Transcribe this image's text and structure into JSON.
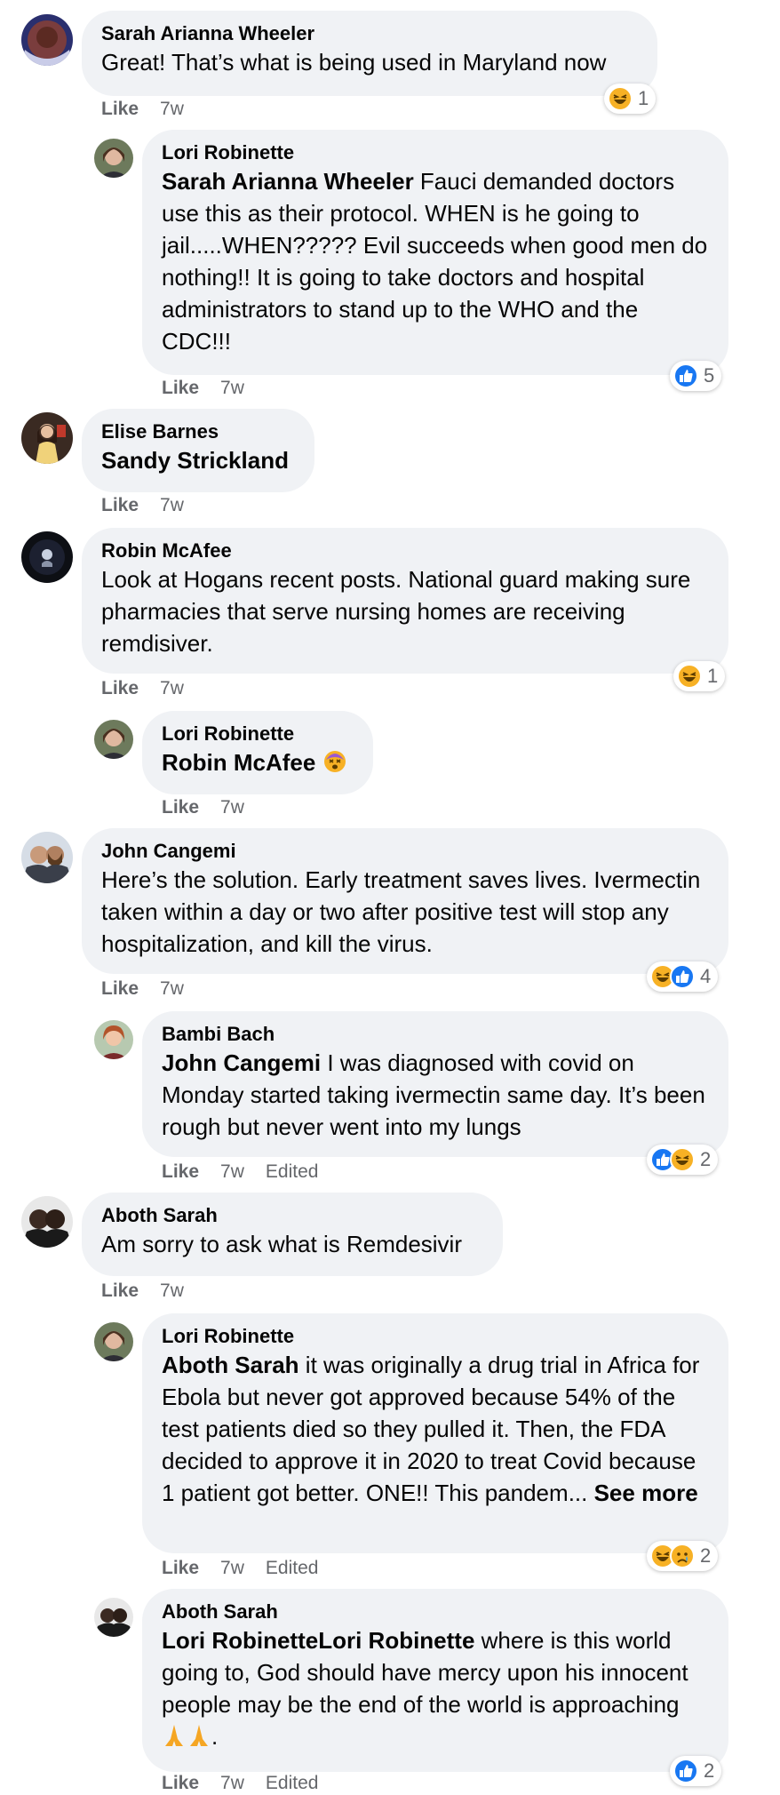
{
  "ui": {
    "like_label": "Like",
    "edited_label": "Edited",
    "see_more_label": "See more",
    "ellipsis": "..."
  },
  "colors": {
    "bubble": "#f0f2f5",
    "meta_text": "#65676b",
    "like_blue": "#1877f2",
    "haha_yellow": "#f7b125"
  },
  "comments": [
    {
      "author": "Sarah Arianna Wheeler",
      "text": "Great! That’s what is being used in Maryland now",
      "time": "7w",
      "reactions": {
        "icons": [
          "haha-icon"
        ],
        "count": "1"
      }
    },
    {
      "author": "Lori Robinette",
      "mention": "Sarah Arianna Wheeler",
      "text": " Fauci demanded doctors use this as their protocol. WHEN is he going to jail.....WHEN????? Evil succeeds when good men do nothing!! It is going to take doctors and hospital administrators to stand up to the WHO and the CDC!!!",
      "time": "7w",
      "reactions": {
        "icons": [
          "like-icon"
        ],
        "count": "5"
      }
    },
    {
      "author": "Elise Barnes",
      "mention": "Sandy Strickland",
      "time": "7w"
    },
    {
      "author": "Robin McAfee",
      "text": "Look at Hogans recent posts. National guard making sure pharmacies that serve nursing homes are receiving remdisiver.",
      "time": "7w",
      "reactions": {
        "icons": [
          "haha-icon"
        ],
        "count": "1"
      }
    },
    {
      "author": "Lori Robinette",
      "mention": "Robin McAfee",
      "emoji": "dizzy-face-emoji",
      "time": "7w"
    },
    {
      "author": "John Cangemi",
      "text": "Here’s the solution. Early treatment saves lives. Ivermectin taken within a day or two after positive test will stop any hospitalization, and kill the virus.",
      "time": "7w",
      "reactions": {
        "icons": [
          "haha-icon",
          "like-icon"
        ],
        "count": "4"
      }
    },
    {
      "author": "Bambi Bach",
      "mention": "John Cangemi",
      "text": " I was diagnosed with covid on Monday started taking ivermectin same day. It’s been rough but never went into my lungs",
      "time": "7w",
      "edited": true,
      "reactions": {
        "icons": [
          "like-icon",
          "haha-icon"
        ],
        "count": "2"
      }
    },
    {
      "author": "Aboth Sarah",
      "text": "Am sorry to ask what is Remdesivir",
      "time": "7w"
    },
    {
      "author": "Lori Robinette",
      "mention": "Aboth Sarah",
      "text": " it was originally a drug trial in Africa for Ebola but never got approved because 54% of the test patients died so they pulled it. Then, the FDA decided to approve it in 2020 to treat Covid because 1 patient got better. ONE!! This pandem",
      "time": "7w",
      "edited": true,
      "reactions": {
        "icons": [
          "haha-icon",
          "sad-icon"
        ],
        "count": "2"
      }
    },
    {
      "author": "Aboth Sarah",
      "mention": "Lori RobinetteLori Robinette",
      "text": " where is this world going to, God should have mercy upon his innocent people may be the end of the world is approaching ",
      "emoji": "folded-hands-emoji",
      "text_end": ".",
      "time": "7w",
      "edited": true,
      "reactions": {
        "icons": [
          "like-icon"
        ],
        "count": "2"
      }
    }
  ]
}
